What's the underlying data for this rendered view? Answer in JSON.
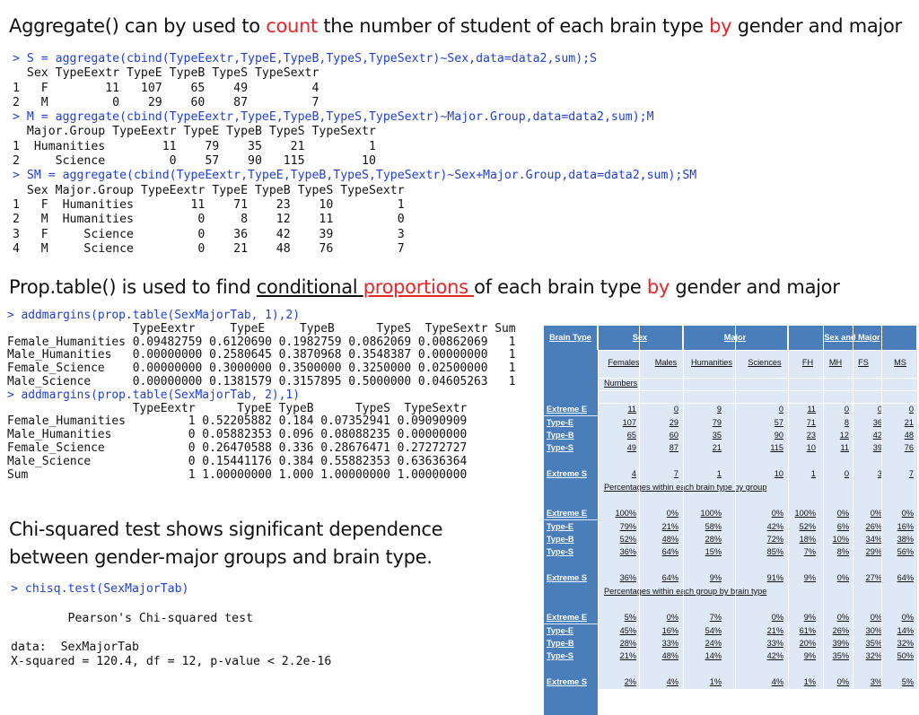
{
  "section1": {
    "heading_pre": "Aggregate() can by used to ",
    "heading_red1": "count",
    "heading_mid": " the number of student of each brain type ",
    "heading_red2": "by",
    "heading_post": " gender and major",
    "code_lines": [
      {
        "cmd": true,
        "text": "> S = aggregate(cbind(TypeEextr,TypeE,TypeB,TypeS,TypeSextr)~Sex,data=data2,sum);S"
      },
      {
        "cmd": false,
        "text": "  Sex TypeEextr TypeE TypeB TypeS TypeSextr"
      },
      {
        "cmd": false,
        "text": "1   F        11   107    65    49         4"
      },
      {
        "cmd": false,
        "text": "2   M         0    29    60    87         7"
      },
      {
        "cmd": true,
        "text": "> M = aggregate(cbind(TypeEextr,TypeE,TypeB,TypeS,TypeSextr)~Major.Group,data=data2,sum);M"
      },
      {
        "cmd": false,
        "text": "  Major.Group TypeEextr TypeE TypeB TypeS TypeSextr"
      },
      {
        "cmd": false,
        "text": "1  Humanities        11    79    35    21         1"
      },
      {
        "cmd": false,
        "text": "2     Science         0    57    90   115        10"
      },
      {
        "cmd": true,
        "text": "> SM = aggregate(cbind(TypeEextr,TypeE,TypeB,TypeS,TypeSextr)~Sex+Major.Group,data=data2,sum);SM"
      },
      {
        "cmd": false,
        "text": "  Sex Major.Group TypeEextr TypeE TypeB TypeS TypeSextr"
      },
      {
        "cmd": false,
        "text": "1   F  Humanities        11    71    23    10         1"
      },
      {
        "cmd": false,
        "text": "2   M  Humanities         0     8    12    11         0"
      },
      {
        "cmd": false,
        "text": "3   F     Science         0    36    42    39         3"
      },
      {
        "cmd": false,
        "text": "4   M     Science         0    21    48    76         7"
      }
    ]
  },
  "section2": {
    "heading_pre": "Prop.table() is used to find ",
    "heading_u1": "conditional",
    "heading_u_space": " ",
    "heading_u2": "proportions ",
    "heading_mid": "of each brain type ",
    "heading_red": "by",
    "heading_post": " gender and major",
    "code_lines": [
      {
        "cmd": true,
        "text": "> addmargins(prop.table(SexMajorTab, 1),2)"
      },
      {
        "cmd": false,
        "text": "                  TypeEextr     TypeE     TypeB      TypeS  TypeSextr Sum"
      },
      {
        "cmd": false,
        "text": "Female_Humanities 0.09482759 0.6120690 0.1982759 0.0862069 0.00862069   1"
      },
      {
        "cmd": false,
        "text": "Male_Humanities   0.00000000 0.2580645 0.3870968 0.3548387 0.00000000   1"
      },
      {
        "cmd": false,
        "text": "Female_Science    0.00000000 0.3000000 0.3500000 0.3250000 0.02500000   1"
      },
      {
        "cmd": false,
        "text": "Male_Science      0.00000000 0.1381579 0.3157895 0.5000000 0.04605263   1"
      },
      {
        "cmd": true,
        "text": "> addmargins(prop.table(SexMajorTab, 2),1)"
      },
      {
        "cmd": false,
        "text": "                  TypeEextr      TypeE TypeB      TypeS  TypeSextr"
      },
      {
        "cmd": false,
        "text": "Female_Humanities         1 0.52205882 0.184 0.07352941 0.09090909"
      },
      {
        "cmd": false,
        "text": "Male_Humanities           0 0.05882353 0.096 0.08088235 0.00000000"
      },
      {
        "cmd": false,
        "text": "Female_Science            0 0.26470588 0.336 0.28676471 0.27272727"
      },
      {
        "cmd": false,
        "text": "Male_Science              0 0.15441176 0.384 0.55882353 0.63636364"
      },
      {
        "cmd": false,
        "text": "Sum                       1 1.00000000 1.000 1.00000000 1.00000000"
      }
    ]
  },
  "section3": {
    "heading_line1": "Chi-squared test shows significant dependence",
    "heading_line2": "between gender-major groups and brain type.",
    "code_lines": [
      {
        "cmd": true,
        "text": "> chisq.test(SexMajorTab)"
      },
      {
        "cmd": false,
        "text": ""
      },
      {
        "cmd": false,
        "text": "        Pearson's Chi-squared test"
      },
      {
        "cmd": false,
        "text": ""
      },
      {
        "cmd": false,
        "text": "data:  SexMajorTab"
      },
      {
        "cmd": false,
        "text": "X-squared = 120.4, df = 12, p-value < 2.2e-16"
      }
    ]
  },
  "table": {
    "groups": [
      "Brain Type",
      "Sex",
      "Major",
      "Sex and Major"
    ],
    "subheaders": [
      "Females",
      "Males",
      "Humanities",
      "Sciences",
      "FH",
      "MH",
      "FS",
      "MS"
    ],
    "numbers_caption": "Numbers",
    "row_labels": [
      "Extreme E",
      "Type-E",
      "Type-B",
      "Type-S",
      "Extreme S"
    ],
    "sections": [
      {
        "caption": "Percentages within each brain type by group",
        "rows": [
          [
            "11",
            "0",
            "9",
            "0",
            "11",
            "0",
            "0",
            "0"
          ],
          [
            "107",
            "29",
            "79",
            "57",
            "71",
            "8",
            "36",
            "21"
          ],
          [
            "65",
            "60",
            "35",
            "90",
            "23",
            "12",
            "42",
            "48"
          ],
          [
            "49",
            "87",
            "21",
            "115",
            "10",
            "11",
            "39",
            "76"
          ],
          [
            "4",
            "7",
            "1",
            "10",
            "1",
            "0",
            "3",
            "7"
          ]
        ]
      },
      {
        "caption": "Percentages within each group by brain type",
        "rows": [
          [
            "100%",
            "0%",
            "100%",
            "0%",
            "100%",
            "0%",
            "0%",
            "0%"
          ],
          [
            "79%",
            "21%",
            "58%",
            "42%",
            "52%",
            "6%",
            "26%",
            "16%"
          ],
          [
            "52%",
            "48%",
            "28%",
            "72%",
            "18%",
            "10%",
            "34%",
            "38%"
          ],
          [
            "36%",
            "64%",
            "15%",
            "85%",
            "7%",
            "8%",
            "29%",
            "56%"
          ],
          [
            "36%",
            "64%",
            "9%",
            "91%",
            "9%",
            "0%",
            "27%",
            "64%"
          ]
        ]
      },
      {
        "caption": "",
        "rows": [
          [
            "5%",
            "0%",
            "7%",
            "0%",
            "9%",
            "0%",
            "0%",
            "0%"
          ],
          [
            "45%",
            "16%",
            "54%",
            "21%",
            "61%",
            "26%",
            "30%",
            "14%"
          ],
          [
            "28%",
            "33%",
            "24%",
            "33%",
            "20%",
            "39%",
            "35%",
            "32%"
          ],
          [
            "21%",
            "48%",
            "14%",
            "42%",
            "9%",
            "35%",
            "32%",
            "50%"
          ],
          [
            "2%",
            "4%",
            "1%",
            "4%",
            "1%",
            "0%",
            "3%",
            "5%"
          ]
        ]
      }
    ],
    "colors": {
      "header_blue": "#4a7ebb",
      "cell_bg": "#dfe9f5",
      "accent_red": "#e8262a",
      "code_blue": "#1f3fd6"
    }
  }
}
